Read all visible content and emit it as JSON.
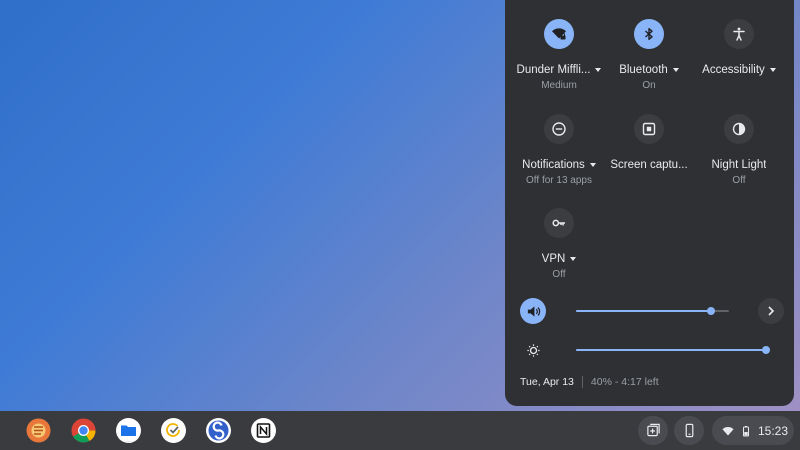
{
  "quick_settings": {
    "tiles": [
      {
        "label": "Dunder Miffli...",
        "sub": "Medium",
        "icon": "wifi-lock-icon",
        "on": true,
        "has_menu": true
      },
      {
        "label": "Bluetooth",
        "sub": "On",
        "icon": "bluetooth-icon",
        "on": true,
        "has_menu": true
      },
      {
        "label": "Accessibility",
        "sub": "",
        "icon": "accessibility-icon",
        "on": false,
        "has_menu": true
      },
      {
        "label": "Notifications",
        "sub": "Off for 13 apps",
        "icon": "do-not-disturb-icon",
        "on": false,
        "has_menu": true
      },
      {
        "label": "Screen captu...",
        "sub": "",
        "icon": "screen-capture-icon",
        "on": false,
        "has_menu": false
      },
      {
        "label": "Night Light",
        "sub": "Off",
        "icon": "night-light-icon",
        "on": false,
        "has_menu": false
      },
      {
        "label": "VPN",
        "sub": "Off",
        "icon": "vpn-key-icon",
        "on": false,
        "has_menu": true
      }
    ],
    "volume": {
      "icon": "volume-icon",
      "level": 0.88
    },
    "brightness": {
      "icon": "brightness-icon",
      "level": 1.0
    },
    "footer": {
      "date": "Tue, Apr 13",
      "battery": "40% - 4:17 left"
    }
  },
  "shelf": {
    "apps": [
      {
        "name": "launcher-app",
        "color": "#e8773b"
      },
      {
        "name": "chrome-app",
        "color": "#ffffff"
      },
      {
        "name": "files-app",
        "color": "#1a73e8",
        "active": true
      },
      {
        "name": "tasks-app",
        "color": "#ffffff"
      },
      {
        "name": "simplenote-app",
        "color": "#ffffff"
      },
      {
        "name": "notion-app",
        "color": "#ffffff"
      }
    ],
    "time": "15:23"
  },
  "colors": {
    "accent": "#8ab4f8",
    "panel": "#2f3034",
    "shelf": "#3a3b3f"
  }
}
